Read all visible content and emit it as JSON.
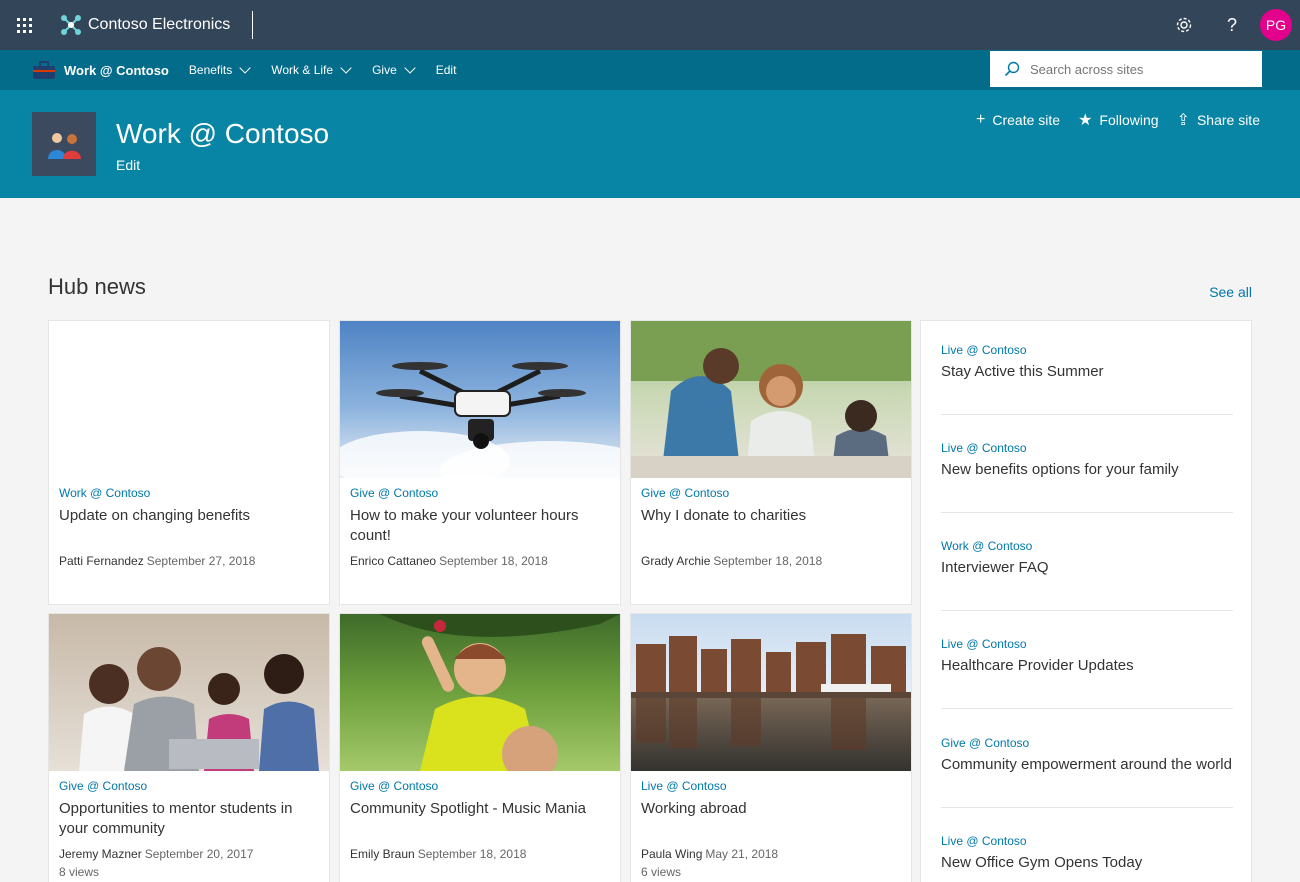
{
  "suite": {
    "brand": "Contoso Electronics",
    "settings_icon": "gear-icon",
    "help_label": "?",
    "avatar_initials": "PG",
    "avatar_color": "#e3008c"
  },
  "hubnav": {
    "title": "Work @ Contoso",
    "links": [
      {
        "label": "Benefits",
        "dropdown": true
      },
      {
        "label": "Work & Life",
        "dropdown": true
      },
      {
        "label": "Give",
        "dropdown": true
      },
      {
        "label": "Edit",
        "dropdown": false
      }
    ]
  },
  "site": {
    "title": "Work @ Contoso",
    "edit_label": "Edit",
    "create_site": "Create site",
    "following": "Following",
    "share_site": "Share site",
    "search_placeholder": "Search across sites"
  },
  "news": {
    "title": "Hub news",
    "see_all": "See all",
    "cards": [
      {
        "site": "Work @ Contoso",
        "title": "Update on changing benefits",
        "author": "Patti Fernandez",
        "date": "September 27, 2018",
        "views": ""
      },
      {
        "site": "Give @ Contoso",
        "title": "How to make your volunteer hours count!",
        "author": "Enrico Cattaneo",
        "date": "September 18, 2018",
        "views": ""
      },
      {
        "site": "Give @ Contoso",
        "title": "Why I donate to charities",
        "author": "Grady Archie",
        "date": "September 18, 2018",
        "views": ""
      },
      {
        "site": "Give @ Contoso",
        "title": "Opportunities to mentor students in your community",
        "author": "Jeremy Mazner",
        "date": "September 20, 2017",
        "views": "8 views"
      },
      {
        "site": "Give @ Contoso",
        "title": "Community Spotlight - Music Mania",
        "author": "Emily Braun",
        "date": "September 18, 2018",
        "views": ""
      },
      {
        "site": "Live @ Contoso",
        "title": "Working abroad",
        "author": "Paula Wing",
        "date": "May 21, 2018",
        "views": "6 views"
      }
    ],
    "side_items": [
      {
        "site": "Live @ Contoso",
        "title": "Stay Active this Summer"
      },
      {
        "site": "Live @ Contoso",
        "title": "New benefits options for your family"
      },
      {
        "site": "Work @ Contoso",
        "title": "Interviewer FAQ"
      },
      {
        "site": "Live @ Contoso",
        "title": "Healthcare Provider Updates"
      },
      {
        "site": "Give @ Contoso",
        "title": "Community empowerment around the world"
      },
      {
        "site": "Live @ Contoso",
        "title": "New Office Gym Opens Today"
      }
    ]
  },
  "colors": {
    "suitebar": "#334559",
    "hubnav": "#036c8a",
    "header": "#0884a4",
    "link": "#0078a8"
  }
}
